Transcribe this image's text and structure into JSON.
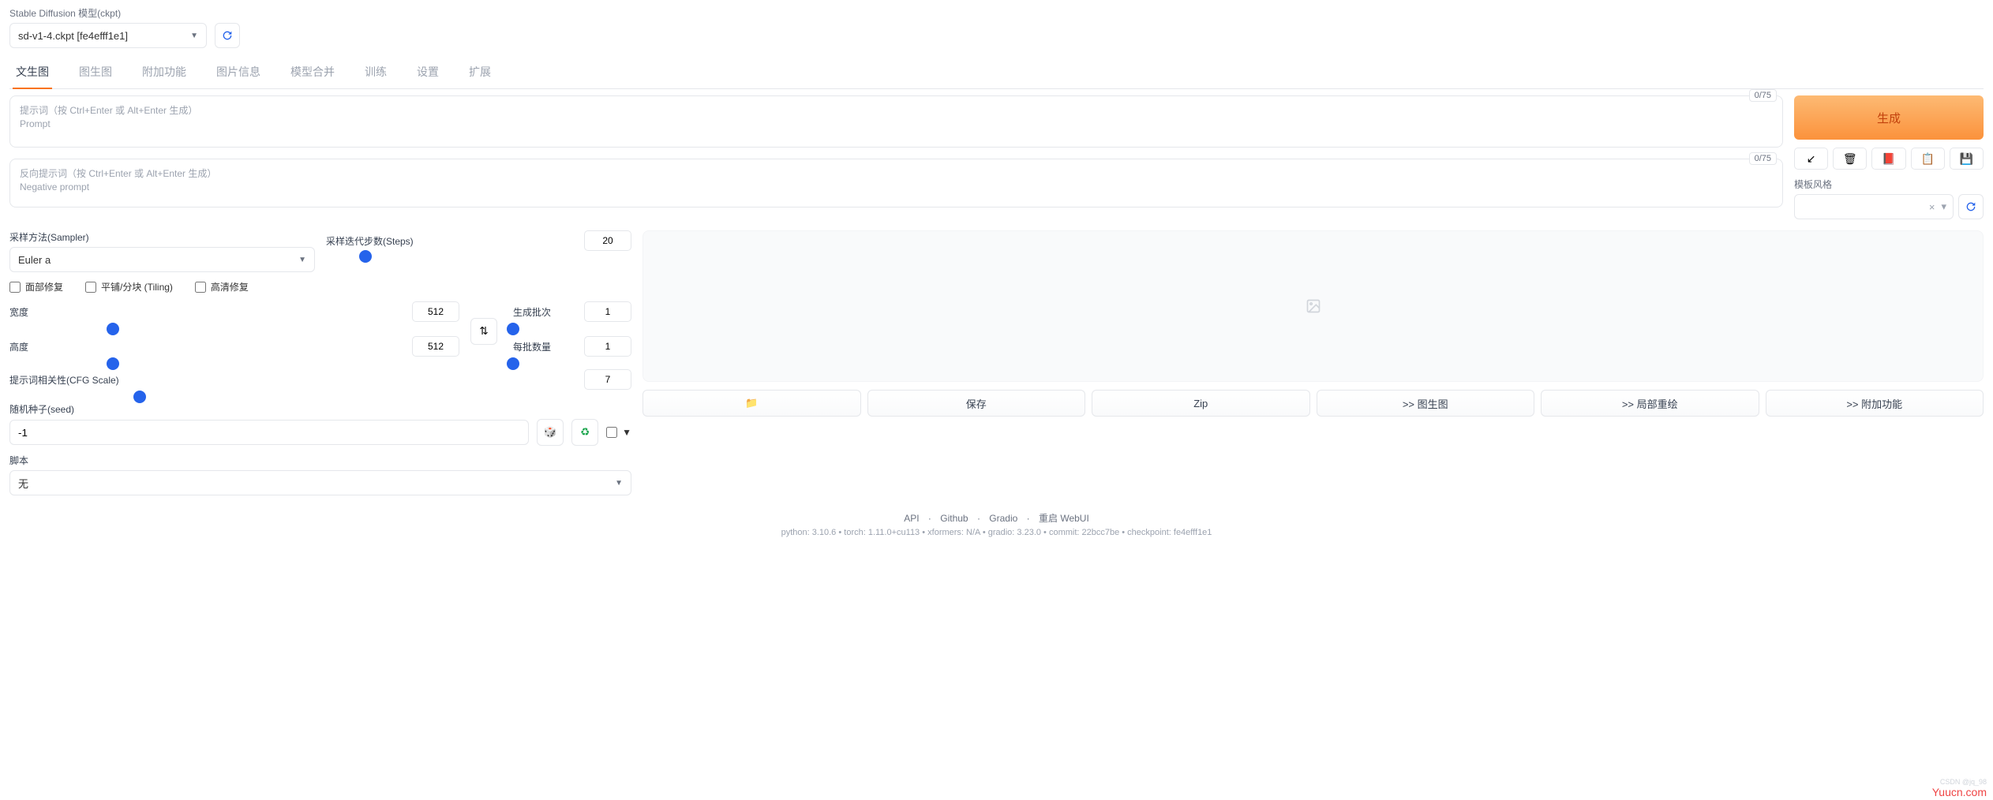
{
  "header": {
    "model_label": "Stable Diffusion 模型(ckpt)",
    "model_value": "sd-v1-4.ckpt [fe4efff1e1]"
  },
  "tabs": [
    "文生图",
    "图生图",
    "附加功能",
    "图片信息",
    "模型合并",
    "训练",
    "设置",
    "扩展"
  ],
  "prompt": {
    "counter1": "0/75",
    "ph1_line1": "提示词（按 Ctrl+Enter 或 Alt+Enter 生成）",
    "ph1_line2": "Prompt",
    "counter2": "0/75",
    "ph2_line1": "反向提示词（按 Ctrl+Enter 或 Alt+Enter 生成）",
    "ph2_line2": "Negative prompt"
  },
  "generate": {
    "btn": "生成",
    "style_label": "模板风格",
    "style_clear": "×",
    "style_caret": "▾"
  },
  "icons": {
    "arrow": "↙",
    "trash": "🗑",
    "book": "📕",
    "clip": "📋",
    "save": "💾"
  },
  "controls": {
    "sampler_label": "采样方法(Sampler)",
    "sampler_value": "Euler a",
    "steps_label": "采样迭代步数(Steps)",
    "steps_value": "20",
    "face_restore": "面部修复",
    "tiling": "平铺/分块 (Tiling)",
    "hires": "高清修复",
    "width_label": "宽度",
    "width_value": "512",
    "height_label": "高度",
    "height_value": "512",
    "batch_count_label": "生成批次",
    "batch_count_value": "1",
    "batch_size_label": "每批数量",
    "batch_size_value": "1",
    "cfg_label": "提示词相关性(CFG Scale)",
    "cfg_value": "7",
    "seed_label": "随机种子(seed)",
    "seed_value": "-1",
    "extra_caret": "▼",
    "script_label": "脚本",
    "script_value": "无",
    "swap": "⇅",
    "dice": "🎲",
    "recycle": "♻"
  },
  "actions": {
    "folder": "📁",
    "save": "保存",
    "zip": "Zip",
    "img2img": ">> 图生图",
    "inpaint": ">> 局部重绘",
    "extras": ">> 附加功能"
  },
  "footer": {
    "links": [
      "API",
      "Github",
      "Gradio",
      "重启 WebUI"
    ],
    "sep": "·",
    "info": "python: 3.10.6  •  torch: 1.11.0+cu113  •  xformers: N/A  •  gradio: 3.23.0  •  commit: 22bcc7be  •  checkpoint: fe4efff1e1"
  },
  "brand": {
    "wm": "CSDN @jq_98",
    "yc": "Yuucn.com"
  }
}
